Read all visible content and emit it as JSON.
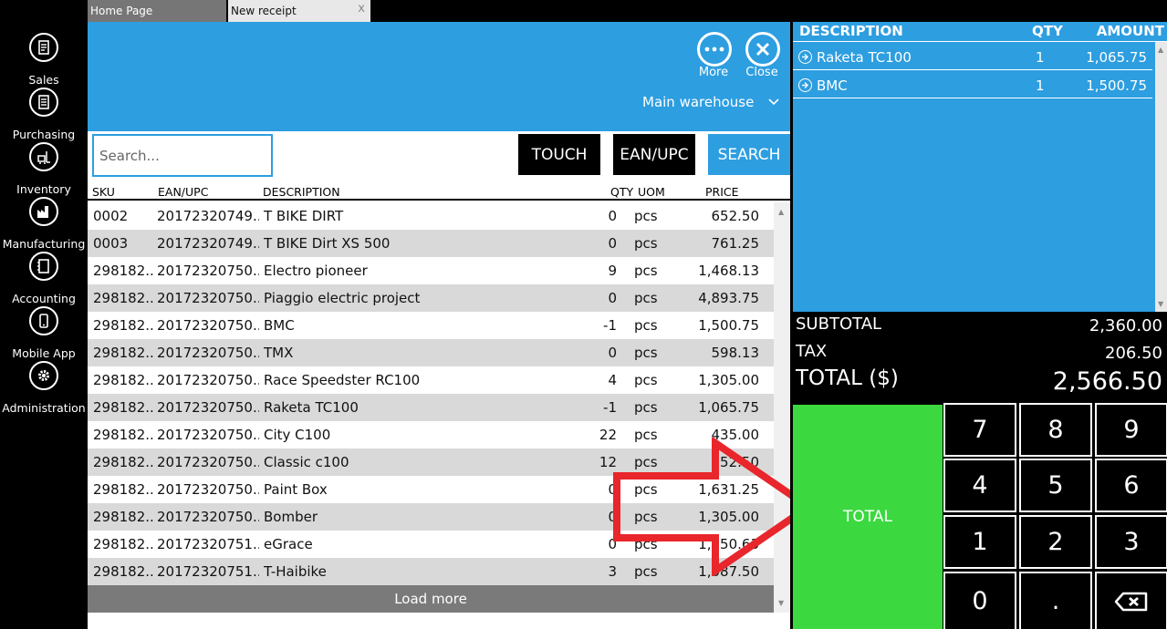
{
  "tabs": [
    {
      "label": "Home Page"
    },
    {
      "label": "New receipt",
      "close": "x"
    }
  ],
  "sidebar": {
    "items": [
      {
        "label": "Sales",
        "icon": "sales-icon"
      },
      {
        "label": "Purchasing",
        "icon": "purchasing-icon"
      },
      {
        "label": "Inventory",
        "icon": "inventory-icon"
      },
      {
        "label": "Manufacturing",
        "icon": "manufacturing-icon"
      },
      {
        "label": "Accounting",
        "icon": "accounting-icon"
      },
      {
        "label": "Mobile App",
        "icon": "mobile-app-icon"
      },
      {
        "label": "Administration",
        "icon": "gear-icon"
      }
    ]
  },
  "header": {
    "more_label": "More",
    "close_label": "Close",
    "warehouse": "Main warehouse"
  },
  "search": {
    "placeholder": "Search...",
    "value": "",
    "touch_label": "TOUCH",
    "ean_label": "EAN/UPC",
    "search_label": "SEARCH"
  },
  "grid": {
    "columns": {
      "sku": "SKU",
      "ean": "EAN/UPC",
      "description": "DESCRIPTION",
      "qty": "QTY",
      "uom": "UOM",
      "price": "PRICE"
    },
    "rows": [
      {
        "sku": "0002",
        "ean": "20172320749...",
        "description": "T BIKE DIRT",
        "qty": "0",
        "uom": "pcs",
        "price": "652.50"
      },
      {
        "sku": "0003",
        "ean": "20172320749...",
        "description": "T BIKE Dirt XS 500",
        "qty": "0",
        "uom": "pcs",
        "price": "761.25"
      },
      {
        "sku": "298182...",
        "ean": "20172320750...",
        "description": "Electro pioneer",
        "qty": "9",
        "uom": "pcs",
        "price": "1,468.13"
      },
      {
        "sku": "298182...",
        "ean": "20172320750...",
        "description": "Piaggio electric project",
        "qty": "0",
        "uom": "pcs",
        "price": "4,893.75"
      },
      {
        "sku": "298182...",
        "ean": "20172320750...",
        "description": "BMC",
        "qty": "-1",
        "uom": "pcs",
        "price": "1,500.75"
      },
      {
        "sku": "298182...",
        "ean": "20172320750...",
        "description": "TMX",
        "qty": "0",
        "uom": "pcs",
        "price": "598.13"
      },
      {
        "sku": "298182...",
        "ean": "20172320750...",
        "description": "Race Speedster RC100",
        "qty": "4",
        "uom": "pcs",
        "price": "1,305.00"
      },
      {
        "sku": "298182...",
        "ean": "20172320750...",
        "description": "Raketa TC100",
        "qty": "-1",
        "uom": "pcs",
        "price": "1,065.75"
      },
      {
        "sku": "298182...",
        "ean": "20172320750...",
        "description": "City C100",
        "qty": "22",
        "uom": "pcs",
        "price": "435.00"
      },
      {
        "sku": "298182...",
        "ean": "20172320750...",
        "description": "Classic c100",
        "qty": "12",
        "uom": "pcs",
        "price": "652.50"
      },
      {
        "sku": "298182...",
        "ean": "20172320750...",
        "description": "Paint Box",
        "qty": "0",
        "uom": "pcs",
        "price": "1,631.25"
      },
      {
        "sku": "298182...",
        "ean": "20172320750...",
        "description": "Bomber",
        "qty": "0",
        "uom": "pcs",
        "price": "1,305.00"
      },
      {
        "sku": "298182...",
        "ean": "20172320751...",
        "description": "eGrace",
        "qty": "0",
        "uom": "pcs",
        "price": "1,250.63"
      },
      {
        "sku": "298182...",
        "ean": "20172320751...",
        "description": "T-Haibike",
        "qty": "3",
        "uom": "pcs",
        "price": "1,087.50"
      }
    ],
    "load_more": "Load more"
  },
  "cart": {
    "columns": {
      "description": "DESCRIPTION",
      "qty": "QTY",
      "amount": "AMOUNT"
    },
    "lines": [
      {
        "description": "Raketa TC100",
        "qty": "1",
        "amount": "1,065.75"
      },
      {
        "description": "BMC",
        "qty": "1",
        "amount": "1,500.75"
      }
    ]
  },
  "totals": {
    "subtotal_label": "SUBTOTAL",
    "subtotal": "2,360.00",
    "tax_label": "TAX",
    "tax": "206.50",
    "total_label": "TOTAL ($)",
    "total": "2,566.50"
  },
  "keypad": {
    "total_label": "TOTAL",
    "keys": [
      "7",
      "8",
      "9",
      "4",
      "5",
      "6",
      "1",
      "2",
      "3",
      "0",
      "."
    ],
    "backspace_icon": "backspace-icon"
  },
  "colors": {
    "accent": "#2d9ee0",
    "total_button": "#3bd93f",
    "arrow": "#e8262b"
  }
}
